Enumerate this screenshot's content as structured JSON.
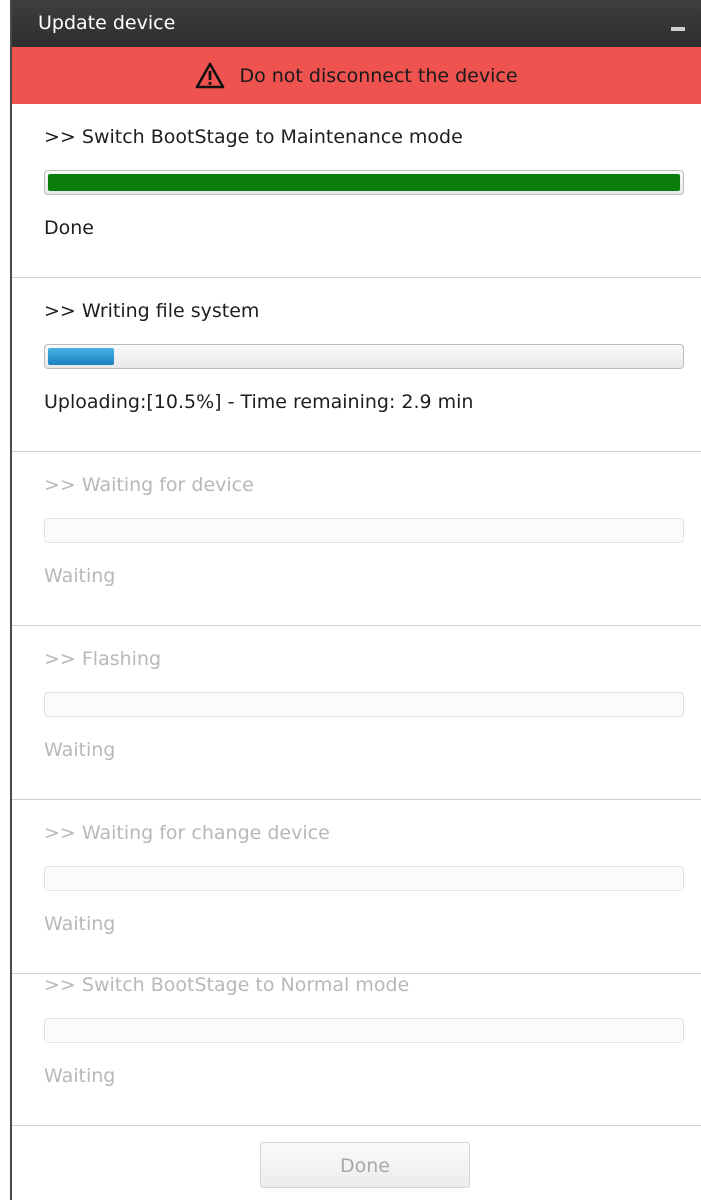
{
  "window": {
    "title": "Update device"
  },
  "warning": {
    "text": "Do not disconnect the device",
    "icon": "warning-triangle-icon"
  },
  "steps": [
    {
      "title": ">> Switch BootStage to Maintenance mode",
      "progress": 1.0,
      "status": "Done",
      "state": "done"
    },
    {
      "title": ">> Writing file system",
      "progress": 0.105,
      "status": "Uploading:[10.5%] - Time remaining: 2.9 min",
      "state": "active"
    },
    {
      "title": ">> Waiting for device",
      "progress": 0,
      "status": "Waiting",
      "state": "pending"
    },
    {
      "title": ">> Flashing",
      "progress": 0,
      "status": "Waiting",
      "state": "pending"
    },
    {
      "title": ">> Waiting for change device",
      "progress": 0,
      "status": "Waiting",
      "state": "pending"
    },
    {
      "title": ">> Switch BootStage to Normal mode",
      "progress": 0,
      "status": "Waiting",
      "state": "pending"
    }
  ],
  "footer": {
    "done_label": "Done",
    "done_enabled": false
  },
  "colors": {
    "warning_bg": "#ef5350",
    "progress_done": "#0b7d0b",
    "progress_active": "#2a95d3",
    "titlebar": "#333333"
  }
}
